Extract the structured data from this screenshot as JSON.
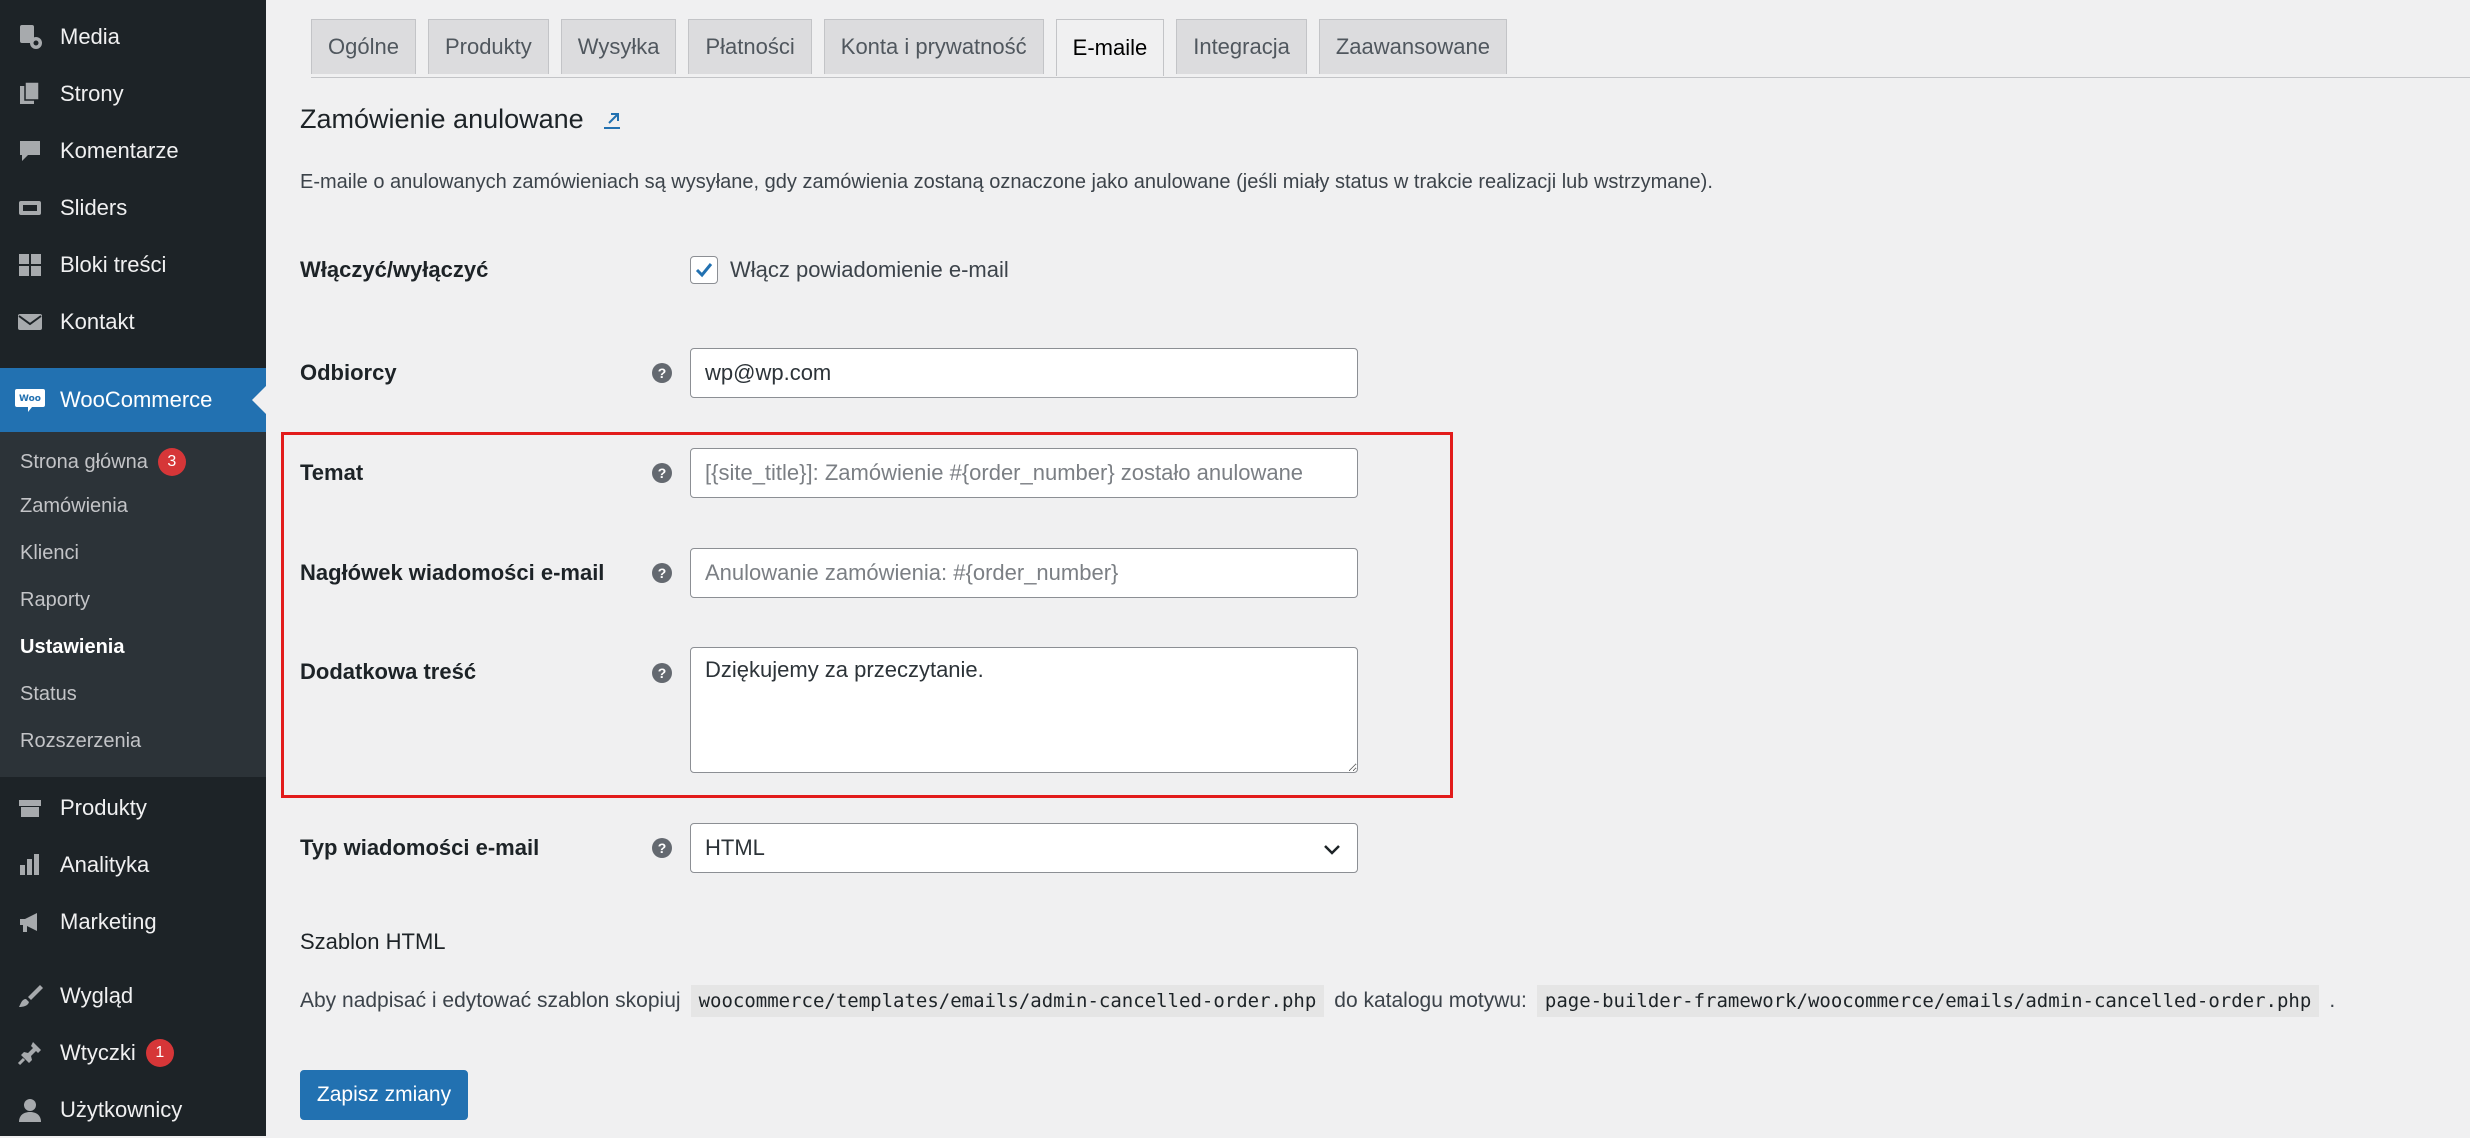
{
  "sidebar": {
    "top_items": [
      {
        "label": "Media",
        "icon": "media-icon"
      },
      {
        "label": "Strony",
        "icon": "pages-icon"
      },
      {
        "label": "Komentarze",
        "icon": "comments-icon"
      },
      {
        "label": "Sliders",
        "icon": "sliders-icon"
      },
      {
        "label": "Bloki treści",
        "icon": "blocks-icon"
      },
      {
        "label": "Kontakt",
        "icon": "mail-icon"
      }
    ],
    "woocommerce": {
      "label": "WooCommerce",
      "icon": "woocommerce-icon"
    },
    "submenu": [
      {
        "label": "Strona główna",
        "badge": "3"
      },
      {
        "label": "Zamówienia"
      },
      {
        "label": "Klienci"
      },
      {
        "label": "Raporty"
      },
      {
        "label": "Ustawienia",
        "current": true
      },
      {
        "label": "Status"
      },
      {
        "label": "Rozszerzenia"
      }
    ],
    "bottom_items": [
      {
        "label": "Produkty",
        "icon": "products-icon"
      },
      {
        "label": "Analityka",
        "icon": "analytics-icon"
      },
      {
        "label": "Marketing",
        "icon": "megaphone-icon"
      },
      {
        "label": "Wygląd",
        "icon": "appearance-icon"
      },
      {
        "label": "Wtyczki",
        "icon": "plugins-icon",
        "badge": "1"
      },
      {
        "label": "Użytkownicy",
        "icon": "users-icon"
      }
    ]
  },
  "tabs": [
    "Ogólne",
    "Produkty",
    "Wysyłka",
    "Płatności",
    "Konta i prywatność",
    "E-maile",
    "Integracja",
    "Zaawansowane"
  ],
  "active_tab": "E-maile",
  "section": {
    "title": "Zamówienie anulowane",
    "description": "E-maile o anulowanych zamówieniach są wysyłane, gdy zamówienia zostaną oznaczone jako anulowane (jeśli miały status w trakcie realizacji lub wstrzymane)."
  },
  "form": {
    "enable": {
      "label": "Włączyć/wyłączyć",
      "checkbox_label": "Włącz powiadomienie e-mail",
      "checked": true
    },
    "recipient": {
      "label": "Odbiorcy",
      "value": "wp@wp.com"
    },
    "subject": {
      "label": "Temat",
      "placeholder": "[{site_title}]: Zamówienie #{order_number} zostało anulowane"
    },
    "heading": {
      "label": "Nagłówek wiadomości e-mail",
      "placeholder": "Anulowanie zamówienia: #{order_number}"
    },
    "additional": {
      "label": "Dodatkowa treść",
      "value": "Dziękujemy za przeczytanie."
    },
    "email_type": {
      "label": "Typ wiadomości e-mail",
      "value": "HTML"
    }
  },
  "template": {
    "heading": "Szablon HTML",
    "text_before": "Aby nadpisać i edytować szablon skopiuj",
    "path1": "woocommerce/templates/emails/admin-cancelled-order.php",
    "text_middle": "do katalogu motywu:",
    "path2": "page-builder-framework/woocommerce/emails/admin-cancelled-order.php",
    "text_after": "."
  },
  "save_button": "Zapisz zmiany",
  "colors": {
    "sidebar": "#1d2327",
    "accent": "#2271b1",
    "highlight": "#e21b1b",
    "badge": "#d63638"
  }
}
